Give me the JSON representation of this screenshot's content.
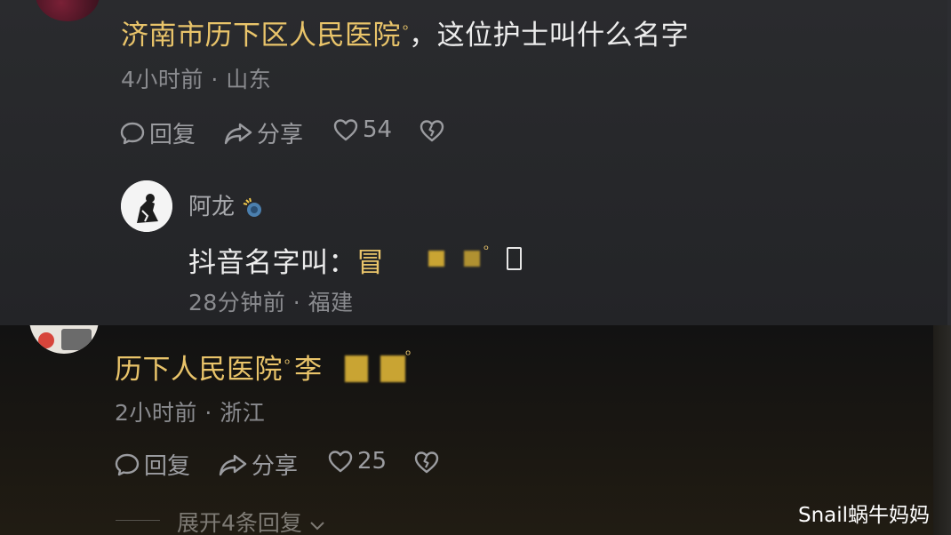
{
  "comment1": {
    "link_text": "济南市历下区人民医院",
    "search_mark": "ᵒ",
    "text": "，这位护士叫什么名字",
    "time": "4小时前",
    "separator": "·",
    "location": "山东",
    "reply_label": "回复",
    "share_label": "分享",
    "like_count": "54"
  },
  "reply1": {
    "author": "阿龙",
    "text_prefix": "抖音名字叫：",
    "partial_char": "冒",
    "time": "28分钟前",
    "separator": "·",
    "location": "福建"
  },
  "comment2": {
    "link_text_1": "历下人民医院",
    "search_mark": "ᵒ",
    "link_text_2": "李",
    "time": "2小时前",
    "separator": "·",
    "location": "浙江",
    "reply_label": "回复",
    "share_label": "分享",
    "like_count": "25",
    "expand_label": "展开4条回复"
  },
  "watermark": "Snail蜗牛妈妈",
  "colors": {
    "link": "#e9c46a",
    "text": "#ececec",
    "meta": "#8a8b8f",
    "top_panel_bg": "#2a2b2e",
    "bottom_panel_bg": "#121212"
  },
  "icons": [
    "comment-icon",
    "share-icon",
    "heart-icon",
    "dislike-heart-icon",
    "chevron-down-icon",
    "search-icon"
  ]
}
